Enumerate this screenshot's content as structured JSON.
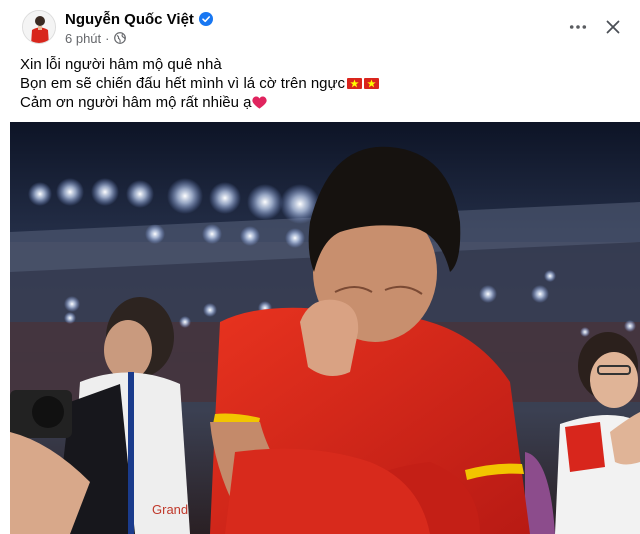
{
  "post": {
    "author": "Nguyễn Quốc Việt",
    "time": "6 phút",
    "separator": "·",
    "lines": [
      "Xin lỗi người hâm mộ quê nhà",
      "Bọn em sẽ chiến đấu hết mình vì lá cờ trên ngực",
      "Cảm ơn người hâm mộ rất nhiều ạ"
    ],
    "icons": {
      "verified": "verified-badge-icon",
      "audience": "globe-icon",
      "more": "more-options-icon",
      "close": "close-icon",
      "flag": "vietnam-flag-emoji",
      "heart": "red-heart-emoji"
    },
    "photo_brand_text": "Grand"
  },
  "colors": {
    "verified_blue": "#1877f2",
    "meta_gray": "#65676b",
    "flag_red": "#da251d",
    "flag_star": "#ffff00",
    "jersey_red": "#d8261c",
    "jersey_yellow": "#f2c500"
  }
}
